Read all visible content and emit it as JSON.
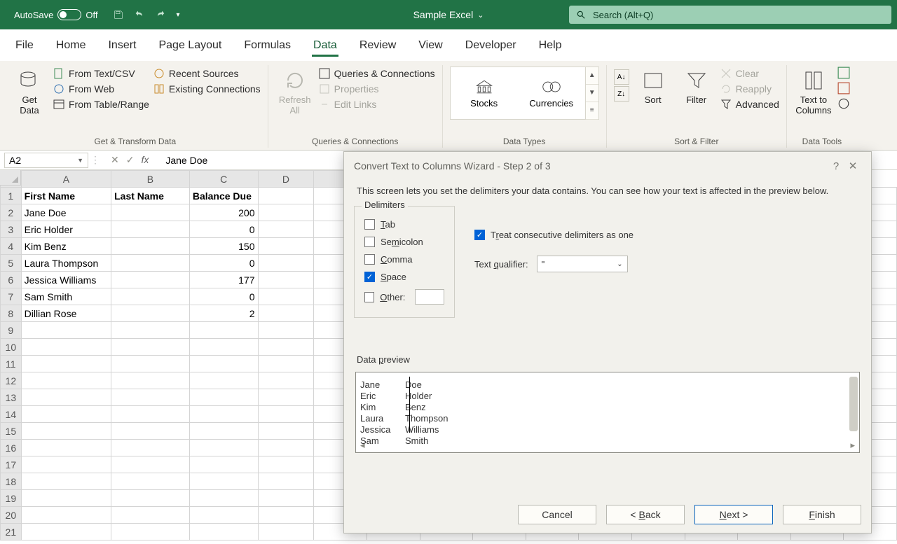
{
  "titlebar": {
    "autosave_label": "AutoSave",
    "autosave_state": "Off",
    "doc_title": "Sample Excel",
    "search_placeholder": "Search (Alt+Q)"
  },
  "tabs": {
    "file": "File",
    "home": "Home",
    "insert": "Insert",
    "pagelayout": "Page Layout",
    "formulas": "Formulas",
    "data": "Data",
    "review": "Review",
    "view": "View",
    "developer": "Developer",
    "help": "Help"
  },
  "ribbon": {
    "get_transform": {
      "get_data": "Get\nData",
      "from_text": "From Text/CSV",
      "from_web": "From Web",
      "from_table": "From Table/Range",
      "recent": "Recent Sources",
      "existing": "Existing Connections",
      "label": "Get & Transform Data"
    },
    "queries": {
      "refresh": "Refresh\nAll",
      "qc": "Queries & Connections",
      "props": "Properties",
      "edit": "Edit Links",
      "label": "Queries & Connections"
    },
    "data_types": {
      "stocks": "Stocks",
      "currencies": "Currencies",
      "label": "Data Types"
    },
    "sort_filter": {
      "sort": "Sort",
      "filter": "Filter",
      "clear": "Clear",
      "reapply": "Reapply",
      "advanced": "Advanced",
      "label": "Sort & Filter"
    },
    "data_tools": {
      "text_to_columns": "Text to\nColumns",
      "label": "Data Tools"
    }
  },
  "formula_bar": {
    "cell_ref": "A2",
    "value": "Jane Doe"
  },
  "sheet": {
    "columns": [
      "A",
      "B",
      "C",
      "D"
    ],
    "headers": {
      "A": "First Name",
      "B": "Last Name",
      "C": "Balance Due"
    },
    "rows": [
      {
        "A": "Jane Doe",
        "C": "200"
      },
      {
        "A": "Eric Holder",
        "C": "0"
      },
      {
        "A": "Kim Benz",
        "C": "150"
      },
      {
        "A": "Laura Thompson",
        "C": "0"
      },
      {
        "A": "Jessica Williams",
        "C": "177"
      },
      {
        "A": "Sam Smith",
        "C": "0"
      },
      {
        "A": "Dillian Rose",
        "C": "2"
      }
    ]
  },
  "dialog": {
    "title": "Convert Text to Columns Wizard - Step 2 of 3",
    "intro": "This screen lets you set the delimiters your data contains.  You can see how your text is affected in the preview below.",
    "delimiters_legend": "Delimiters",
    "delim_tab": "Tab",
    "delim_semicolon": "Semicolon",
    "delim_comma": "Comma",
    "delim_space": "Space",
    "delim_other": "Other:",
    "treat_consecutive": "Treat consecutive delimiters as one",
    "text_qualifier_label": "Text qualifier:",
    "text_qualifier_value": "\"",
    "preview_label": "Data preview",
    "preview_rows": [
      {
        "c1": "Jane",
        "c2": "Doe"
      },
      {
        "c1": "Eric",
        "c2": "Holder"
      },
      {
        "c1": "Kim",
        "c2": "Benz"
      },
      {
        "c1": "Laura",
        "c2": "Thompson"
      },
      {
        "c1": "Jessica",
        "c2": "Williams"
      },
      {
        "c1": "Sam",
        "c2": "Smith"
      }
    ],
    "buttons": {
      "cancel": "Cancel",
      "back": "< Back",
      "next": "Next >",
      "finish": "Finish"
    },
    "underlines": {
      "tab": "T",
      "semicolon": "S",
      "comma": "C",
      "space": "S",
      "other": "O",
      "treat": "r",
      "qualifier": "q",
      "preview": "p",
      "back": "B",
      "next": "N",
      "finish": "F"
    }
  }
}
